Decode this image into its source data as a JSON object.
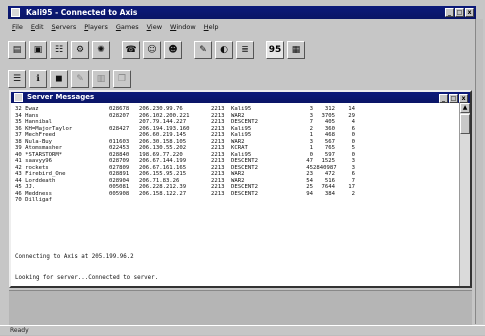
{
  "window": {
    "title": "Kali95 - Connected to Axis",
    "min": "_",
    "max": "□",
    "close": "x"
  },
  "menu": [
    "File",
    "Edit",
    "Servers",
    "Players",
    "Games",
    "View",
    "Window",
    "Help"
  ],
  "toolbar_icons": [
    "open-icon",
    "connect-icon",
    "network-icon",
    "settings-icon",
    "gear-icon",
    "chat-icon",
    "person-icon",
    "users-icon",
    "paint-icon",
    "phone-icon",
    "notes-icon"
  ],
  "toolbar_95": "95",
  "toolbar2_icons": [
    "list-icon",
    "info-icon",
    "kick-icon",
    "edit-icon",
    "chart-icon",
    "copy-icon"
  ],
  "child": {
    "title": "Server Messages",
    "rows": [
      [
        "32 Ewaz",
        "028678",
        "206.230.99.76",
        "2213",
        "Kali95",
        "3",
        "312",
        "14"
      ],
      [
        "34 Hans",
        "028207",
        "206.102.200.221",
        "2213",
        "WAR2",
        "3",
        "3705",
        "29"
      ],
      [
        "35 Hannibal",
        "",
        "207.79.144.227",
        "2213",
        "DESCENT2",
        "7",
        "405",
        "4"
      ],
      [
        "36 KH=MajorTaylor",
        "028427",
        "206.194.193.160",
        "2213",
        "Kali95",
        "2",
        "360",
        "6"
      ],
      [
        "37 MechFreed",
        "",
        "206.60.219.145",
        "2213",
        "Kali95",
        "1",
        "468",
        "0"
      ],
      [
        "38 Nula-Buy",
        "011603",
        "206.30.158.105",
        "2213",
        "WAR2",
        "3",
        "567",
        "0"
      ],
      [
        "39 Atomsmasher",
        "022453",
        "206.130.55.202",
        "2213",
        "KCRAT",
        "1",
        "765",
        "5"
      ],
      [
        "40 *STARSTORM*",
        "028840",
        "198.69.77.220",
        "2213",
        "Kali95",
        "0",
        "597",
        "0"
      ],
      [
        "41 saavyy96",
        "028709",
        "206.67.144.199",
        "2213",
        "DESCENT2",
        "47",
        "1525",
        "3"
      ],
      [
        "42 rockets",
        "027809",
        "206.67.161.165",
        "2213",
        "DESCENT2",
        "45",
        "2840987",
        "3"
      ],
      [
        "43 Firebird_One",
        "028891",
        "206.155.95.215",
        "2213",
        "WAR2",
        "23",
        "472",
        "6"
      ],
      [
        "44 Lorddeath",
        "028904",
        "206.71.83.26",
        "2213",
        "WAR2",
        "54",
        "516",
        "7"
      ],
      [
        "45 JJ.",
        "005081",
        "206.228.212.39",
        "2213",
        "DESCENT2",
        "25",
        "7644",
        "17"
      ],
      [
        "46 Meddness",
        "005908",
        "206.158.122.27",
        "2213",
        "DESCENT2",
        "94",
        "384",
        "2"
      ],
      [
        "70 Dilligaf",
        "",
        "",
        "",
        "",
        "",
        "",
        ""
      ]
    ],
    "messages": [
      "Connecting to Axis at 205.199.96.2",
      "Looking for server...Connected to server."
    ]
  },
  "status": "Ready"
}
